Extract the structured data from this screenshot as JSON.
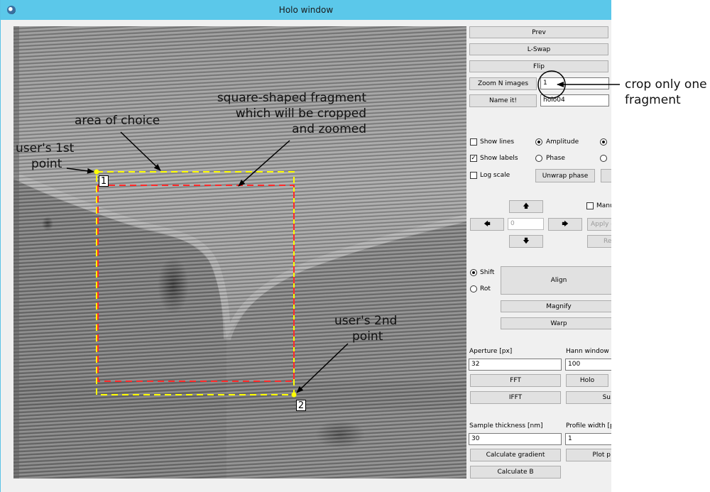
{
  "window": {
    "title": "Holo window",
    "icon": "app-globe-icon"
  },
  "annotations": {
    "area_of_choice": "area of choice",
    "fragment_line1": "square-shaped fragment",
    "fragment_line2": "which will be cropped",
    "fragment_line3": "and zoomed",
    "first_point_line1": "user's 1st",
    "first_point_line2": "point",
    "second_point_line1": "user's 2nd",
    "second_point_line2": "point",
    "crop_line1": "crop only one",
    "crop_line2": "fragment",
    "marker1": "1",
    "marker2": "2"
  },
  "panel": {
    "prev": "Prev",
    "lswap": "L-Swap",
    "flip": "Flip",
    "zoom_n_images": "Zoom N images",
    "zoom_n_value": "1",
    "name_it": "Name it!",
    "name_value": "holo04",
    "show_lines": "Show lines",
    "show_labels": "Show labels",
    "log_scale": "Log scale",
    "amplitude": "Amplitude",
    "phase": "Phase",
    "unwrap_phase": "Unwrap phase",
    "arrow_up": "🡅",
    "arrow_down": "🡇",
    "arrow_left": "🡄",
    "arrow_right": "🡆",
    "shift_value": "0",
    "manual_label": "Manu",
    "apply_label": "Apply c",
    "reset_label": "Res",
    "shift": "Shift",
    "rot": "Rot",
    "align": "Align",
    "magnify": "Magnify",
    "warp": "Warp",
    "aperture_label": "Aperture [px]",
    "aperture_value": "32",
    "hann_label": "Hann window [px",
    "hann_value": "100",
    "fft": "FFT",
    "holo": "Holo",
    "ifft": "IFFT",
    "sum_label": "Su",
    "thickness_label": "Sample thickness [nm]",
    "thickness_value": "30",
    "profile_label": "Profile width [px",
    "profile_value": "1",
    "calc_gradient": "Calculate gradient",
    "plot_profile": "Plot p",
    "calc_b": "Calculate B"
  },
  "colors": {
    "titlebar": "#5bc8ea",
    "selection_yellow": "#ffff00",
    "crop_red": "#ff2a2a"
  }
}
